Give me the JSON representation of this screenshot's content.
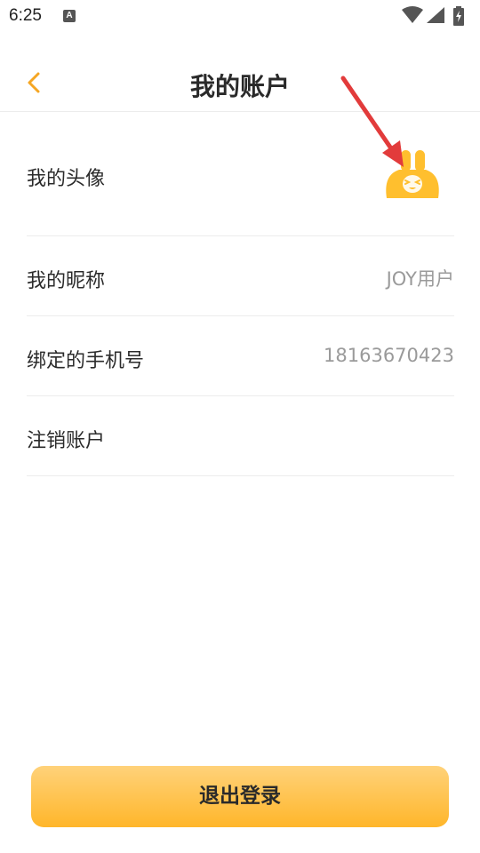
{
  "status_bar": {
    "time": "6:25",
    "notification_letter": "A",
    "icons": [
      "a-notification-icon",
      "wifi-icon",
      "signal-icon",
      "battery-charging-icon"
    ]
  },
  "header": {
    "title": "我的账户",
    "back_icon": "chevron-left-icon"
  },
  "rows": [
    {
      "label": "我的头像",
      "value_type": "avatar",
      "avatar_icon": "rabbit-avatar-icon"
    },
    {
      "label": "我的昵称",
      "value": "JOY用户"
    },
    {
      "label": "绑定的手机号",
      "value": "18163670423"
    },
    {
      "label": "注销账户"
    }
  ],
  "footer": {
    "logout_label": "退出登录"
  },
  "colors": {
    "accent": "#f5a623",
    "button_top": "#ffd27a",
    "button_bottom": "#ffb62a",
    "avatar": "#ffbf2e",
    "divider": "#ececec",
    "value_text": "#9a9a9a",
    "annotation_arrow": "#e23b3b"
  }
}
